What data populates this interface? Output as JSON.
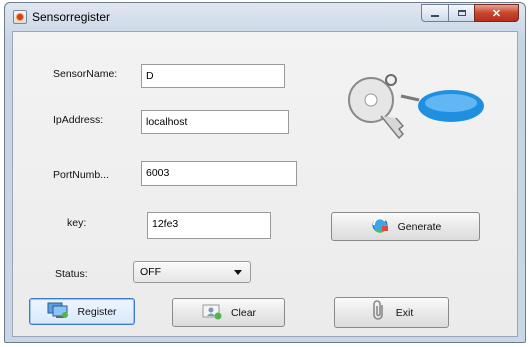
{
  "window": {
    "title": "Sensorregister"
  },
  "form": {
    "sensor_name": {
      "label": "SensorName:",
      "value": "D"
    },
    "ip_address": {
      "label": "IpAddress:",
      "value": "localhost"
    },
    "port_number": {
      "label": "PortNumb...",
      "value": "6003"
    },
    "key": {
      "label": "key:",
      "value": "12fe3"
    },
    "status": {
      "label": "Status:",
      "selected": "OFF"
    }
  },
  "buttons": {
    "generate": "Generate",
    "register": "Register",
    "clear": "Clear",
    "exit": "Exit"
  },
  "icons": {
    "app": "java-icon",
    "keys": "keys-icon",
    "generate": "refresh-icon",
    "register": "computer-network-icon",
    "clear": "user-clear-icon",
    "exit": "paperclip-icon"
  }
}
